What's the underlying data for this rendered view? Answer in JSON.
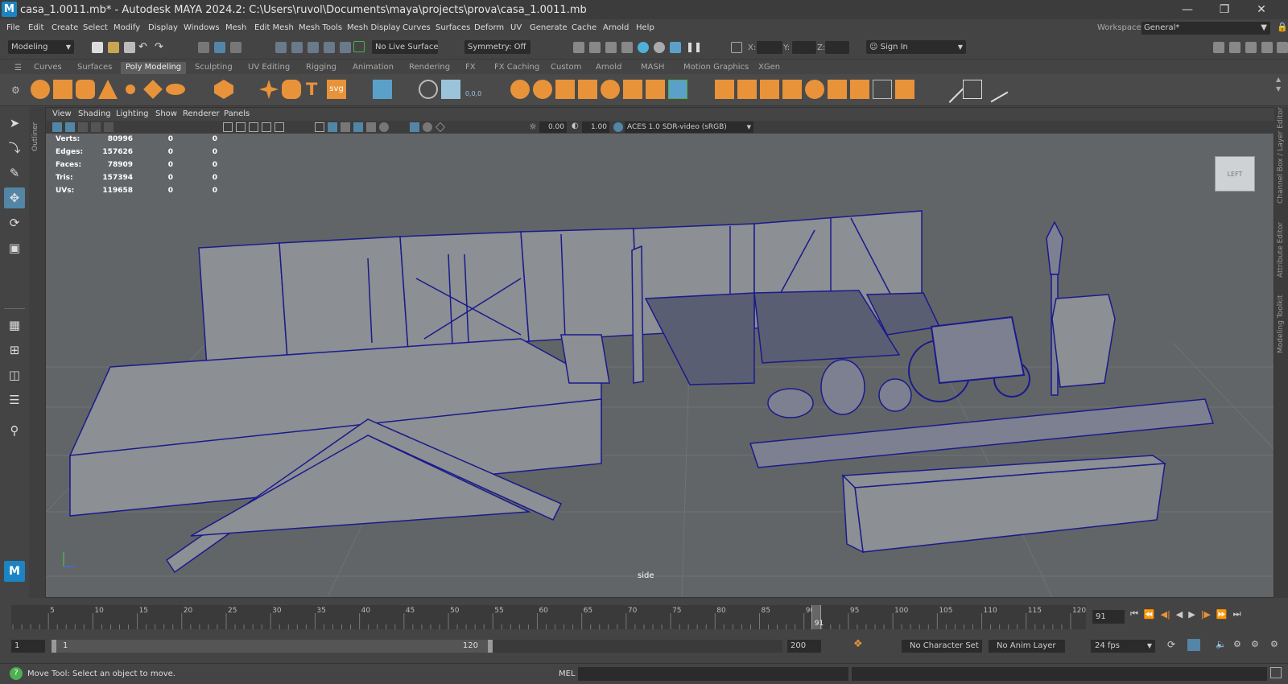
{
  "window": {
    "app_icon": "M",
    "title": "casa_1.0011.mb* - Autodesk MAYA 2024.2: C:\\Users\\ruvol\\Documents\\maya\\projects\\prova\\casa_1.0011.mb",
    "buttons": [
      "minimize",
      "restore",
      "close"
    ]
  },
  "menubar": {
    "items": [
      "File",
      "Edit",
      "Create",
      "Select",
      "Modify",
      "Display",
      "Windows",
      "Mesh",
      "Edit Mesh",
      "Mesh Tools",
      "Mesh Display",
      "Curves",
      "Surfaces",
      "Deform",
      "UV",
      "Generate",
      "Cache",
      "Arnold",
      "Help"
    ],
    "workspace_label": "Workspace:",
    "workspace_value": "General*"
  },
  "statusline": {
    "mode": "Modeling",
    "live_surface": "No Live Surface",
    "symmetry": "Symmetry: Off",
    "x_label": "X:",
    "y_label": "Y:",
    "z_label": "Z:",
    "sign_in": "Sign In"
  },
  "shelf": {
    "tabs": [
      "Curves",
      "Surfaces",
      "Poly Modeling",
      "Sculpting",
      "UV Editing",
      "Rigging",
      "Animation",
      "Rendering",
      "FX",
      "FX Caching",
      "Custom",
      "Arnold",
      "MASH",
      "Motion Graphics",
      "XGen"
    ],
    "active_tab": "Poly Modeling",
    "svg_label": "svg",
    "zero_label": "0,0,0"
  },
  "outliner_label": "Outliner",
  "viewport": {
    "panel_menus": [
      "View",
      "Shading",
      "Lighting",
      "Show",
      "Renderer",
      "Panels"
    ],
    "exposure": "0.00",
    "gamma": "1.00",
    "color_space": "ACES 1.0 SDR-video (sRGB)",
    "hud": [
      {
        "label": "Verts:",
        "v1": "80996",
        "v2": "0",
        "v3": "0"
      },
      {
        "label": "Edges:",
        "v1": "157626",
        "v2": "0",
        "v3": "0"
      },
      {
        "label": "Faces:",
        "v1": "78909",
        "v2": "0",
        "v3": "0"
      },
      {
        "label": "Tris:",
        "v1": "157394",
        "v2": "0",
        "v3": "0"
      },
      {
        "label": "UVs:",
        "v1": "119658",
        "v2": "0",
        "v3": "0"
      }
    ],
    "camera_name": "side",
    "viewcube_label": "LEFT",
    "wire_color": "#1a1a8c",
    "mesh_fill": "#8a8d91"
  },
  "right_strip": [
    "Channel Box / Layer Editor",
    "Attribute Editor",
    "Modeling Toolkit"
  ],
  "timeline": {
    "ticks": [
      "5",
      "10",
      "15",
      "20",
      "25",
      "30",
      "35",
      "40",
      "45",
      "50",
      "55",
      "60",
      "65",
      "70",
      "75",
      "80",
      "85",
      "90",
      "95",
      "100",
      "105",
      "110",
      "115",
      "120"
    ],
    "current_frame": "91",
    "current_frame_field": "91"
  },
  "range": {
    "start": "1",
    "inner_start": "1",
    "inner_end": "120",
    "end": "200",
    "character_set": "No Character Set",
    "anim_layer": "No Anim Layer",
    "fps": "24 fps"
  },
  "helpline": {
    "message": "Move Tool: Select an object to move.",
    "mel_label": "MEL"
  },
  "colors": {
    "accent": "#5285a6",
    "maya_blue": "#1c83c4"
  }
}
